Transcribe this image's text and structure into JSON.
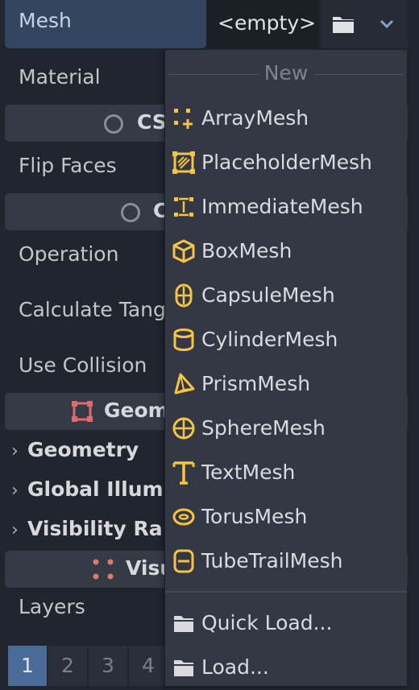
{
  "inspector": {
    "mesh_label": "Mesh",
    "mesh_value": "<empty>",
    "material_label": "Material",
    "section_csg": "CS",
    "flip_faces_label": "Flip Faces",
    "section_c": "C",
    "operation_label": "Operation",
    "calculate_tangents_label": "Calculate Tang",
    "use_collision_label": "Use Collision",
    "section_geom": "Geom",
    "group_geometry": "Geometry",
    "group_global_illum": "Global Illum",
    "group_visibility": "Visibility Ra",
    "section_visu": "Visu",
    "layers_label": "Layers",
    "layers": [
      "1",
      "2",
      "3",
      "4"
    ],
    "active_layer": "1"
  },
  "popup": {
    "section_title": "New",
    "items": [
      {
        "label": "ArrayMesh",
        "icon": "array-mesh-icon"
      },
      {
        "label": "PlaceholderMesh",
        "icon": "placeholder-mesh-icon"
      },
      {
        "label": "ImmediateMesh",
        "icon": "immediate-mesh-icon"
      },
      {
        "label": "BoxMesh",
        "icon": "box-mesh-icon"
      },
      {
        "label": "CapsuleMesh",
        "icon": "capsule-mesh-icon"
      },
      {
        "label": "CylinderMesh",
        "icon": "cylinder-mesh-icon"
      },
      {
        "label": "PrismMesh",
        "icon": "prism-mesh-icon"
      },
      {
        "label": "SphereMesh",
        "icon": "sphere-mesh-icon"
      },
      {
        "label": "TextMesh",
        "icon": "text-mesh-icon"
      },
      {
        "label": "TorusMesh",
        "icon": "torus-mesh-icon"
      },
      {
        "label": "TubeTrailMesh",
        "icon": "tube-trail-mesh-icon"
      }
    ],
    "quick_load": "Quick Load...",
    "load": "Load..."
  },
  "colors": {
    "icon_yellow": "#f5c443",
    "accent_blue": "#4a6b95",
    "popup_bg": "#333844"
  }
}
